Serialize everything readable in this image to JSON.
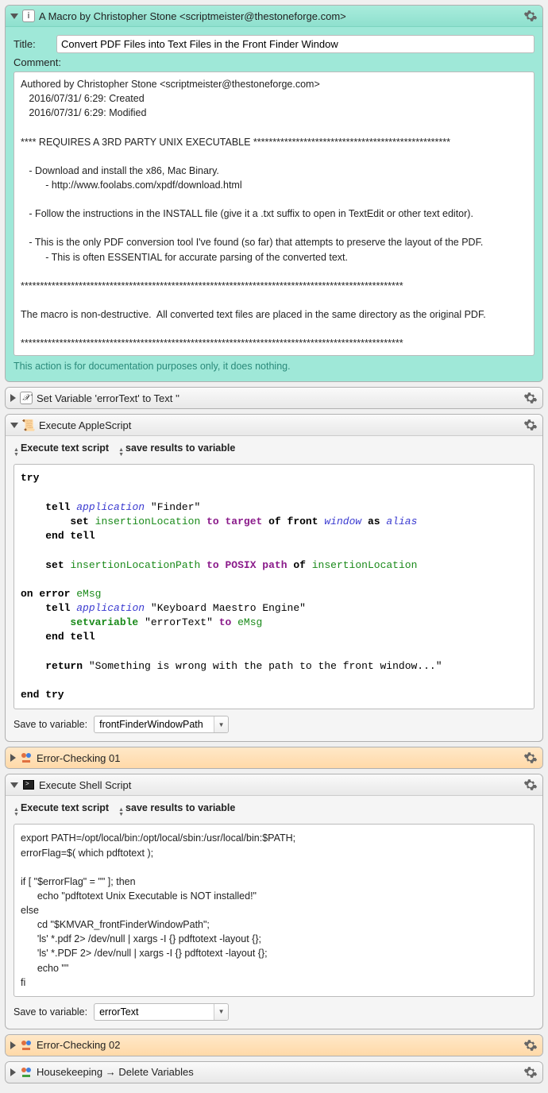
{
  "macro": {
    "header_text": "A Macro by Christopher Stone <scriptmeister@thestoneforge.com>",
    "title_label": "Title:",
    "title_value": "Convert PDF Files into Text Files in the Front Finder Window",
    "comment_label": "Comment:",
    "comment_body": "Authored by Christopher Stone <scriptmeister@thestoneforge.com>\n   2016/07/31/ 6:29: Created\n   2016/07/31/ 6:29: Modified\n\n**** REQUIRES A 3RD PARTY UNIX EXECUTABLE ***************************************************\n\n   - Download and install the x86, Mac Binary.\n         - http://www.foolabs.com/xpdf/download.html\n\n   - Follow the instructions in the INSTALL file (give it a .txt suffix to open in TextEdit or other text editor).\n\n   - This is the only PDF conversion tool I've found (so far) that attempts to preserve the layout of the PDF.\n         - This is often ESSENTIAL for accurate parsing of the converted text.\n\n***************************************************************************************************\n\nThe macro is non-destructive.  All converted text files are placed in the same directory as the original PDF.\n\n***************************************************************************************************",
    "doc_note": "This action is for documentation purposes only, it does nothing."
  },
  "set_var": {
    "header_text": "Set Variable 'errorText' to Text ''"
  },
  "applescript": {
    "header_text": "Execute AppleScript",
    "opt1": "Execute text script",
    "opt2": "save results to variable",
    "save_label": "Save to variable:",
    "save_value": "frontFinderWindowPath"
  },
  "as_code": {
    "try": "try",
    "tell": "tell",
    "application": "application",
    "finder": "\"Finder\"",
    "set": "set",
    "insertionLocation": "insertionLocation",
    "to": "to",
    "target": "target",
    "of_front": "of front",
    "window": "window",
    "as": "as",
    "alias": "alias",
    "end_tell": "end tell",
    "insertionLocationPath": "insertionLocationPath",
    "posix_path": "POSIX path",
    "of": "of",
    "on_error": "on error",
    "eMsg": "eMsg",
    "kme": "\"Keyboard Maestro Engine\"",
    "setvariable": "setvariable",
    "errorText": "\"errorText\"",
    "return": "return",
    "ret_str": "\"Something is wrong with the path to the front window...\"",
    "end_try": "end try"
  },
  "err1": {
    "header_text": "Error-Checking 01"
  },
  "shell": {
    "header_text": "Execute Shell Script",
    "opt1": "Execute text script",
    "opt2": "save results to variable",
    "body": "export PATH=/opt/local/bin:/opt/local/sbin:/usr/local/bin:$PATH;\nerrorFlag=$( which pdftotext );\n\nif [ \"$errorFlag\" = \"\" ]; then\n      echo \"pdftotext Unix Executable is NOT installed!\"\nelse\n      cd \"$KMVAR_frontFinderWindowPath\";\n      'ls' *.pdf 2> /dev/null | xargs -I {} pdftotext -layout {};\n      'ls' *.PDF 2> /dev/null | xargs -I {} pdftotext -layout {};\n      echo \"\"\nfi",
    "save_label": "Save to variable:",
    "save_value": "errorText"
  },
  "err2": {
    "header_text": "Error-Checking 02"
  },
  "housekeeping": {
    "header_text": "Housekeeping → Delete Variables"
  }
}
